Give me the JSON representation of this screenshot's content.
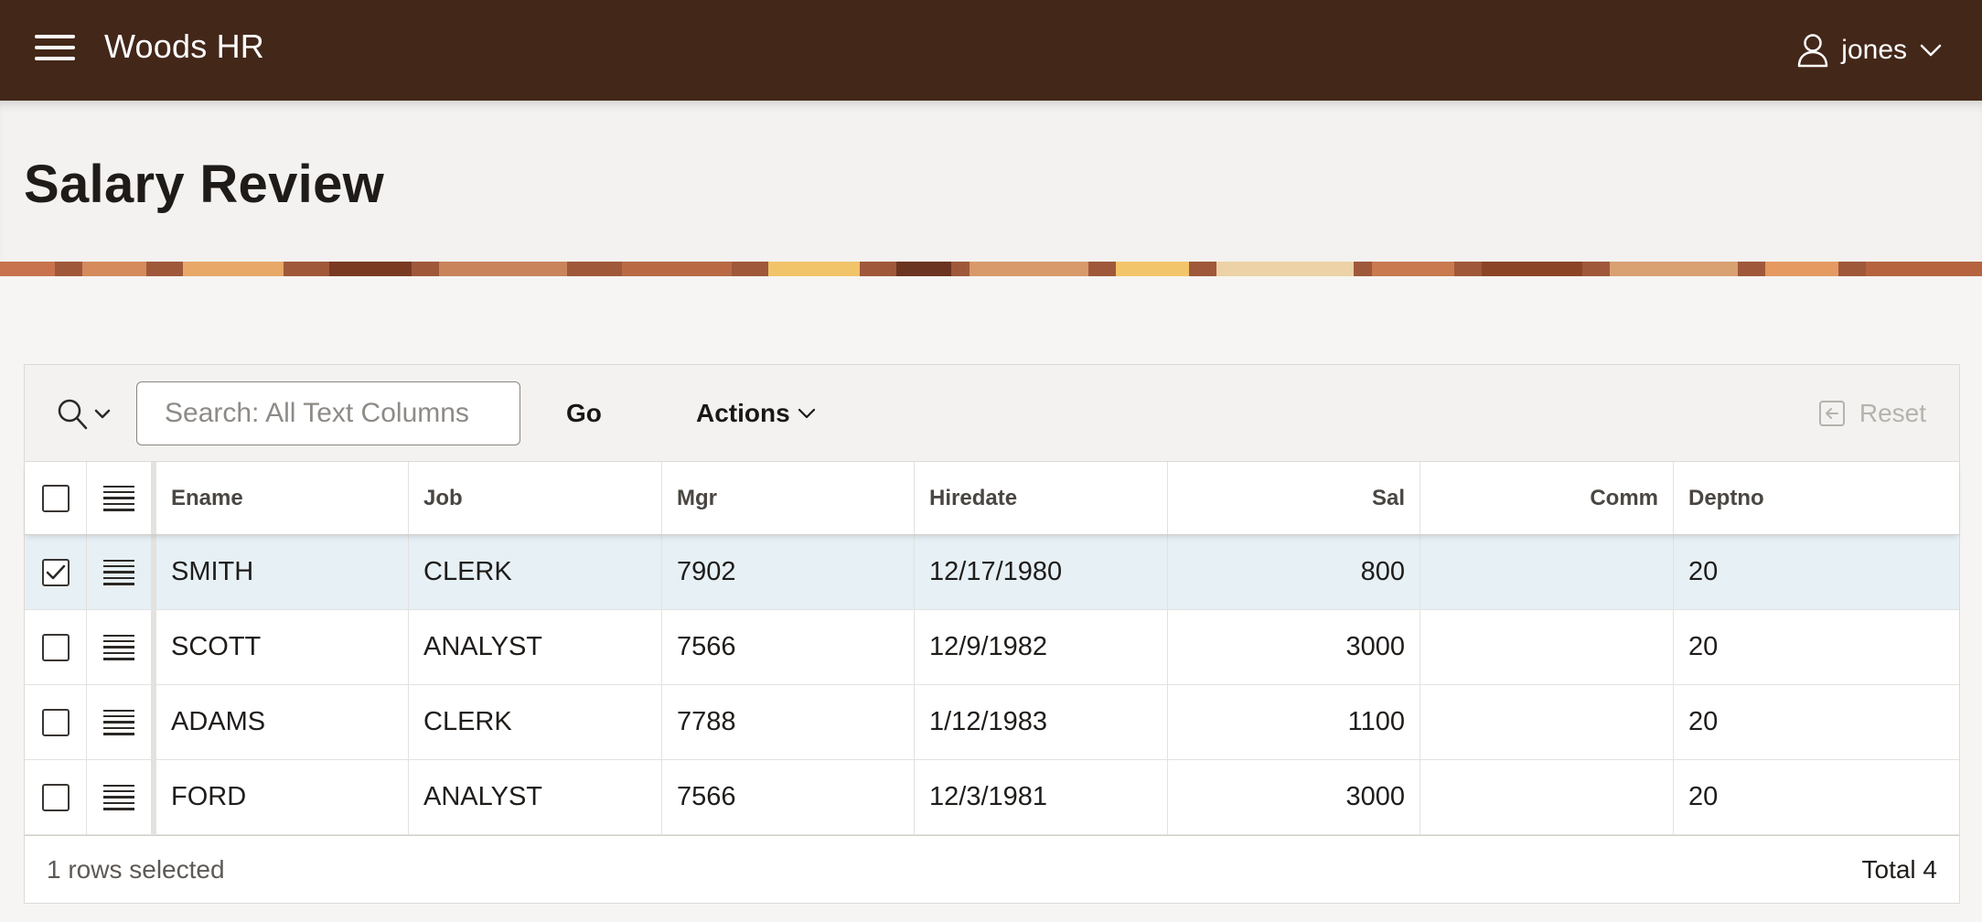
{
  "header": {
    "app_title": "Woods HR",
    "username": "jones",
    "bar_color": "#432719"
  },
  "page": {
    "title": "Salary Review"
  },
  "toolbar": {
    "search_placeholder": "Search: All Text Columns",
    "go_label": "Go",
    "actions_label": "Actions",
    "reset_label": "Reset"
  },
  "grid": {
    "columns": [
      "Ename",
      "Job",
      "Mgr",
      "Hiredate",
      "Sal",
      "Comm",
      "Deptno"
    ],
    "rows": [
      {
        "selected": true,
        "ename": "SMITH",
        "job": "CLERK",
        "mgr": "7902",
        "hiredate": "12/17/1980",
        "sal": "800",
        "comm": "",
        "deptno": "20"
      },
      {
        "selected": false,
        "ename": "SCOTT",
        "job": "ANALYST",
        "mgr": "7566",
        "hiredate": "12/9/1982",
        "sal": "3000",
        "comm": "",
        "deptno": "20"
      },
      {
        "selected": false,
        "ename": "ADAMS",
        "job": "CLERK",
        "mgr": "7788",
        "hiredate": "1/12/1983",
        "sal": "1100",
        "comm": "",
        "deptno": "20"
      },
      {
        "selected": false,
        "ename": "FORD",
        "job": "ANALYST",
        "mgr": "7566",
        "hiredate": "12/3/1981",
        "sal": "3000",
        "comm": "",
        "deptno": "20"
      }
    ]
  },
  "footer": {
    "selection_text": "1 rows selected",
    "total_text": "Total 4"
  }
}
